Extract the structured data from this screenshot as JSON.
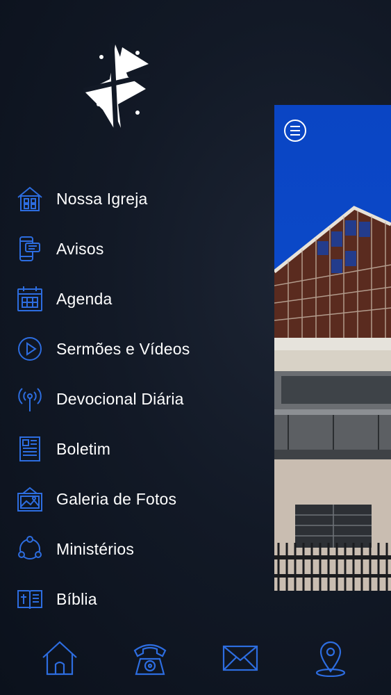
{
  "app": {
    "logo_name": "church-cross-logo",
    "accent_color": "#2d6de0",
    "background_color": "#121926"
  },
  "menu": {
    "items": [
      {
        "label": "Nossa Igreja",
        "icon": "church-building-icon"
      },
      {
        "label": "Avisos",
        "icon": "phone-notice-icon"
      },
      {
        "label": "Agenda",
        "icon": "calendar-icon"
      },
      {
        "label": "Sermões e Vídeos",
        "icon": "play-circle-icon"
      },
      {
        "label": "Devocional Diária",
        "icon": "broadcast-icon"
      },
      {
        "label": "Boletim",
        "icon": "bulletin-icon"
      },
      {
        "label": "Galeria de Fotos",
        "icon": "photo-gallery-icon"
      },
      {
        "label": "Ministérios",
        "icon": "ministries-icon"
      },
      {
        "label": "Bíblia",
        "icon": "bible-icon"
      }
    ]
  },
  "preview": {
    "menu_button_icon": "hamburger-menu-icon"
  },
  "tabbar": {
    "tabs": [
      {
        "icon": "home-icon"
      },
      {
        "icon": "telephone-icon"
      },
      {
        "icon": "envelope-icon"
      },
      {
        "icon": "map-pin-icon"
      }
    ]
  }
}
